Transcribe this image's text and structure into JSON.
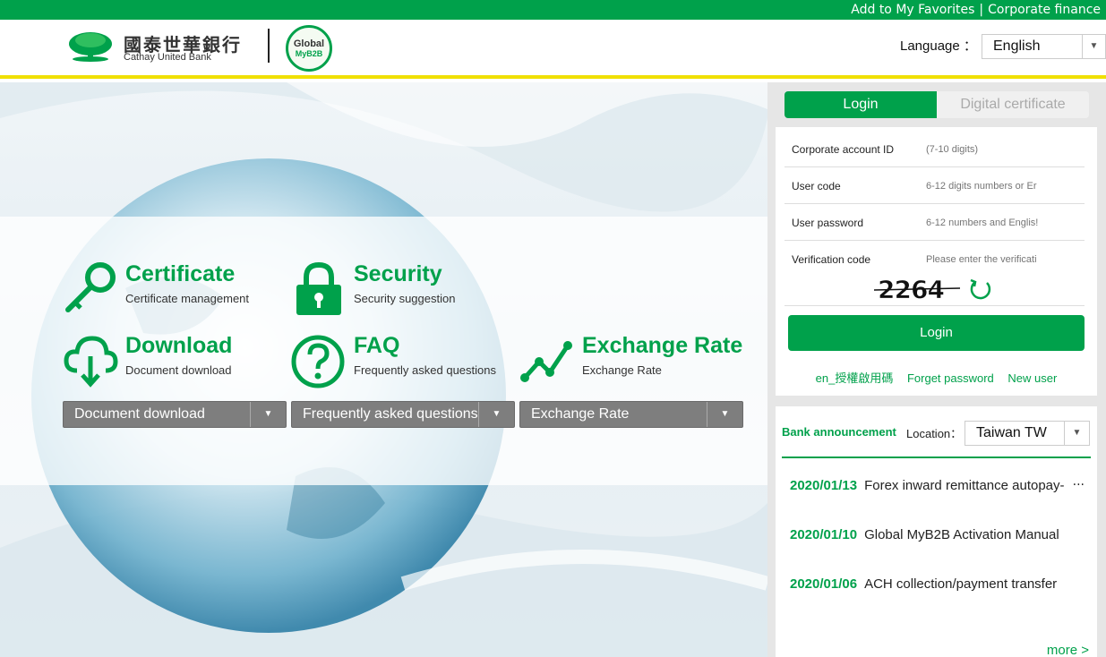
{
  "topbar": {
    "favorites": "Add to My Favorites",
    "separator": "|",
    "corporate": "Corporate finance"
  },
  "header": {
    "logo_chinese": "國泰世華銀行",
    "logo_english": "Cathay United Bank",
    "badge_line1": "Global",
    "badge_line2": "MyB2B",
    "language_label": "Language ：",
    "language_value": "English"
  },
  "features": [
    {
      "title": "Certificate",
      "subtitle": "Certificate management",
      "icon": "key-icon"
    },
    {
      "title": "Security",
      "subtitle": "Security suggestion",
      "icon": "lock-icon"
    },
    {
      "title": "Download",
      "subtitle": "Document download",
      "icon": "cloud-download-icon"
    },
    {
      "title": "FAQ",
      "subtitle": "Frequently asked questions",
      "icon": "question-icon"
    },
    {
      "title": "Exchange Rate",
      "subtitle": "Exchange Rate",
      "icon": "line-chart-icon"
    }
  ],
  "dropdowns": [
    "Document download",
    "Frequently asked questions",
    "Exchange Rate"
  ],
  "login": {
    "tab_login": "Login",
    "tab_certificate": "Digital certificate",
    "fields": [
      {
        "label": "Corporate account ID",
        "placeholder": "(7-10 digits)"
      },
      {
        "label": "User code",
        "placeholder": "6-12 digits numbers or Er"
      },
      {
        "label": "User password",
        "placeholder": "6-12 numbers and Englis!"
      },
      {
        "label": "Verification code",
        "placeholder": "Please enter the verificati"
      }
    ],
    "captcha": "2264",
    "button": "Login",
    "links": [
      "en_授權啟用碼",
      "Forget password",
      "New user"
    ]
  },
  "announcement": {
    "title": "Bank announcement",
    "location_label": "Location：",
    "location_value": "Taiwan TW",
    "items": [
      {
        "date": "2020/01/13",
        "text": "Forex inward remittance autopay-"
      },
      {
        "date": "2020/01/10",
        "text": "Global MyB2B Activation Manual"
      },
      {
        "date": "2020/01/06",
        "text": "ACH collection/payment transfer"
      }
    ],
    "ellipsis": "···",
    "more": "more >"
  },
  "colors": {
    "brand_green": "#00a14b",
    "accent_yellow": "#f0e000",
    "dropdown_gray": "#7e7e7e"
  }
}
